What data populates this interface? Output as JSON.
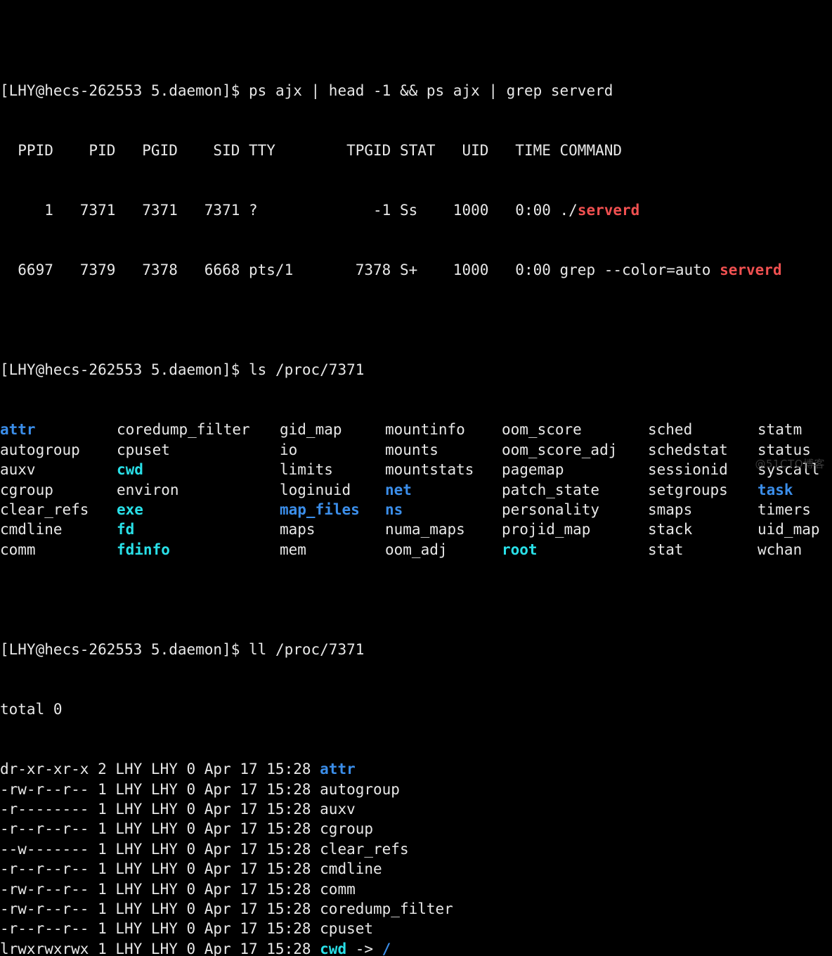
{
  "terminal": {
    "background_color": "#000000",
    "foreground_color": "#e8e8e8",
    "dir_color": "#3b8eea",
    "link_color": "#29e0e8",
    "match_color": "#f05050",
    "watermark": "@51CTO博客"
  },
  "prompt": {
    "text": "[LHY@hecs-262553 5.daemon]$ "
  },
  "blocks": {
    "ps_command": {
      "prompt": "[LHY@hecs-262553 5.daemon]$ ",
      "command": "ps ajx | head -1 && ps ajx | grep serverd",
      "header": "  PPID    PID   PGID    SID TTY        TPGID STAT   UID   TIME COMMAND",
      "rows": [
        {
          "prefix": "     1   7371   7371   7371 ?             -1 Ss    1000   0:00 ./",
          "match": "serverd",
          "suffix": ""
        },
        {
          "prefix": "  6697   7379   7378   6668 pts/1       7378 S+    1000   0:00 grep --color=auto ",
          "match": "serverd",
          "suffix": ""
        }
      ]
    },
    "ls_command": {
      "prompt": "[LHY@hecs-262553 5.daemon]$ ",
      "command": "ls /proc/7371",
      "grid_rows": [
        [
          {
            "name": "attr",
            "type": "dir"
          },
          {
            "name": "coredump_filter",
            "type": "file"
          },
          {
            "name": "gid_map",
            "type": "file"
          },
          {
            "name": "mountinfo",
            "type": "file"
          },
          {
            "name": "oom_score",
            "type": "file"
          },
          {
            "name": "sched",
            "type": "file"
          },
          {
            "name": "statm",
            "type": "file"
          }
        ],
        [
          {
            "name": "autogroup",
            "type": "file"
          },
          {
            "name": "cpuset",
            "type": "file"
          },
          {
            "name": "io",
            "type": "file"
          },
          {
            "name": "mounts",
            "type": "file"
          },
          {
            "name": "oom_score_adj",
            "type": "file"
          },
          {
            "name": "schedstat",
            "type": "file"
          },
          {
            "name": "status",
            "type": "file"
          }
        ],
        [
          {
            "name": "auxv",
            "type": "file"
          },
          {
            "name": "cwd",
            "type": "link"
          },
          {
            "name": "limits",
            "type": "file"
          },
          {
            "name": "mountstats",
            "type": "file"
          },
          {
            "name": "pagemap",
            "type": "file"
          },
          {
            "name": "sessionid",
            "type": "file"
          },
          {
            "name": "syscall",
            "type": "file"
          }
        ],
        [
          {
            "name": "cgroup",
            "type": "file"
          },
          {
            "name": "environ",
            "type": "file"
          },
          {
            "name": "loginuid",
            "type": "file"
          },
          {
            "name": "net",
            "type": "dir"
          },
          {
            "name": "patch_state",
            "type": "file"
          },
          {
            "name": "setgroups",
            "type": "file"
          },
          {
            "name": "task",
            "type": "dir"
          }
        ],
        [
          {
            "name": "clear_refs",
            "type": "file"
          },
          {
            "name": "exe",
            "type": "link"
          },
          {
            "name": "map_files",
            "type": "dir"
          },
          {
            "name": "ns",
            "type": "dir"
          },
          {
            "name": "personality",
            "type": "file"
          },
          {
            "name": "smaps",
            "type": "file"
          },
          {
            "name": "timers",
            "type": "file"
          }
        ],
        [
          {
            "name": "cmdline",
            "type": "file"
          },
          {
            "name": "fd",
            "type": "link"
          },
          {
            "name": "maps",
            "type": "file"
          },
          {
            "name": "numa_maps",
            "type": "file"
          },
          {
            "name": "projid_map",
            "type": "file"
          },
          {
            "name": "stack",
            "type": "file"
          },
          {
            "name": "uid_map",
            "type": "file"
          }
        ],
        [
          {
            "name": "comm",
            "type": "file"
          },
          {
            "name": "fdinfo",
            "type": "link"
          },
          {
            "name": "mem",
            "type": "file"
          },
          {
            "name": "oom_adj",
            "type": "file"
          },
          {
            "name": "root",
            "type": "link"
          },
          {
            "name": "stat",
            "type": "file"
          },
          {
            "name": "wchan",
            "type": "file"
          }
        ]
      ]
    },
    "ll_command": {
      "prompt": "[LHY@hecs-262553 5.daemon]$ ",
      "command": "ll /proc/7371",
      "total_line": "total 0",
      "entries": [
        {
          "perms": "dr-xr-xr-x",
          "links": "2",
          "user": "LHY",
          "group": "LHY",
          "size": "0",
          "date": "Apr 17 15:28",
          "name": "attr",
          "type": "dir",
          "target": ""
        },
        {
          "perms": "-rw-r--r--",
          "links": "1",
          "user": "LHY",
          "group": "LHY",
          "size": "0",
          "date": "Apr 17 15:28",
          "name": "autogroup",
          "type": "file",
          "target": ""
        },
        {
          "perms": "-r--------",
          "links": "1",
          "user": "LHY",
          "group": "LHY",
          "size": "0",
          "date": "Apr 17 15:28",
          "name": "auxv",
          "type": "file",
          "target": ""
        },
        {
          "perms": "-r--r--r--",
          "links": "1",
          "user": "LHY",
          "group": "LHY",
          "size": "0",
          "date": "Apr 17 15:28",
          "name": "cgroup",
          "type": "file",
          "target": ""
        },
        {
          "perms": "--w-------",
          "links": "1",
          "user": "LHY",
          "group": "LHY",
          "size": "0",
          "date": "Apr 17 15:28",
          "name": "clear_refs",
          "type": "file",
          "target": ""
        },
        {
          "perms": "-r--r--r--",
          "links": "1",
          "user": "LHY",
          "group": "LHY",
          "size": "0",
          "date": "Apr 17 15:28",
          "name": "cmdline",
          "type": "file",
          "target": ""
        },
        {
          "perms": "-rw-r--r--",
          "links": "1",
          "user": "LHY",
          "group": "LHY",
          "size": "0",
          "date": "Apr 17 15:28",
          "name": "comm",
          "type": "file",
          "target": ""
        },
        {
          "perms": "-rw-r--r--",
          "links": "1",
          "user": "LHY",
          "group": "LHY",
          "size": "0",
          "date": "Apr 17 15:28",
          "name": "coredump_filter",
          "type": "file",
          "target": ""
        },
        {
          "perms": "-r--r--r--",
          "links": "1",
          "user": "LHY",
          "group": "LHY",
          "size": "0",
          "date": "Apr 17 15:28",
          "name": "cpuset",
          "type": "file",
          "target": ""
        },
        {
          "perms": "lrwxrwxrwx",
          "links": "1",
          "user": "LHY",
          "group": "LHY",
          "size": "0",
          "date": "Apr 17 15:28",
          "name": "cwd",
          "type": "link",
          "target": "/"
        }
      ]
    }
  }
}
